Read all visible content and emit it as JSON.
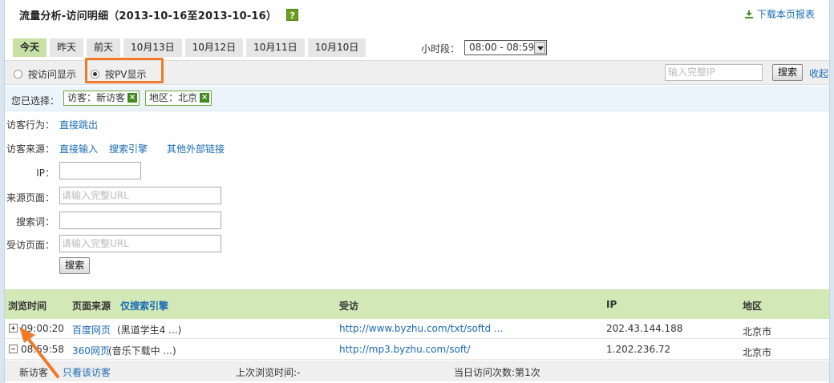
{
  "header": {
    "title": "流量分析-访问明细（2013-10-16至2013-10-16）",
    "help_label": "?",
    "download_label": "下载本页报表"
  },
  "tabs": [
    {
      "label": "今天"
    },
    {
      "label": "昨天"
    },
    {
      "label": "前天"
    },
    {
      "label": "10月13日"
    },
    {
      "label": "10月12日"
    },
    {
      "label": "10月11日"
    },
    {
      "label": "10月10日"
    }
  ],
  "hour": {
    "label": "小时段：",
    "value": "08:00 - 08:59"
  },
  "display": {
    "by_visit": "按访问显示",
    "by_pv": "按PV显示",
    "ip_placeholder": "输入完整IP",
    "search_label": "搜索",
    "collapse_label": "收起"
  },
  "selected": {
    "label": "您已选择：",
    "chips": [
      "访客：新访客",
      "地区：北京"
    ],
    "remove_symbol": "×"
  },
  "filters": {
    "behavior_label": "访客行为：",
    "behavior_link": "直接跳出",
    "source_label": "访客来源：",
    "source_links": [
      "直接输入",
      "搜索引擎",
      "其他外部链接"
    ],
    "ip_label": "IP：",
    "source_page_label": "来源页面：",
    "source_page_placeholder": "请输入完整URL",
    "keyword_label": "搜索词：",
    "visited_page_label": "受访页面：",
    "visited_page_placeholder": "请输入完整URL",
    "search_button": "搜索"
  },
  "table": {
    "headers": {
      "time": "浏览时间",
      "source": "页面来源",
      "source_filter": "仅搜索引擎",
      "visited": "受访",
      "ip": "IP",
      "region": "地区"
    },
    "rows": [
      {
        "time": "09:00:20",
        "source_link": "百度网页",
        "source_extra": "(黑道学生4 ...)",
        "url": "http://www.byzhu.com/txt/softd ...",
        "ip": "202.43.144.188",
        "region": "北京市"
      },
      {
        "time": "08:59:58",
        "source_link": "360网页",
        "source_extra": "(音乐下载中 ...)",
        "url": "http://mp3.byzhu.com/soft/",
        "ip": "1.202.236.72",
        "region": "北京市"
      }
    ],
    "sub_row": {
      "visitor_type": "新访客",
      "only_visitor": "只看该访客",
      "last_visit": "上次浏览时间:-",
      "today_visits": "当日访问次数:第1次"
    }
  },
  "colors": {
    "accent_orange": "#f07a2a",
    "link_blue": "#1a6bb5",
    "header_green": "#d3e8b7",
    "chip_green": "#3f8a21"
  }
}
